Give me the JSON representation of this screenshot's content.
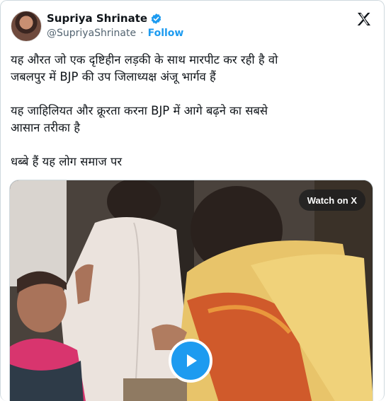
{
  "author": {
    "display_name": "Supriya Shrinate",
    "handle": "@SupriyaShrinate",
    "separator": "·",
    "follow_label": "Follow"
  },
  "icons": {
    "verified": "verified-badge-icon",
    "platform": "x-logo-icon",
    "play": "play-icon"
  },
  "tweet": {
    "paragraphs": [
      "यह औरत जो एक दृष्टिहीन लड़की के साथ मारपीट कर रही है वो\nजबलपुर में BJP की उप जिलाध्यक्ष अंजू भार्गव हैं",
      "यह जाहिलियत और क्रूरता करना BJP में आगे बढ़ने का सबसे\nआसान तरीका है",
      "धब्बे हैं यह लोग समाज पर"
    ]
  },
  "media": {
    "watch_label": "Watch on X"
  },
  "colors": {
    "accent": "#1d9bf0",
    "text": "#0f1419",
    "muted": "#536471"
  }
}
